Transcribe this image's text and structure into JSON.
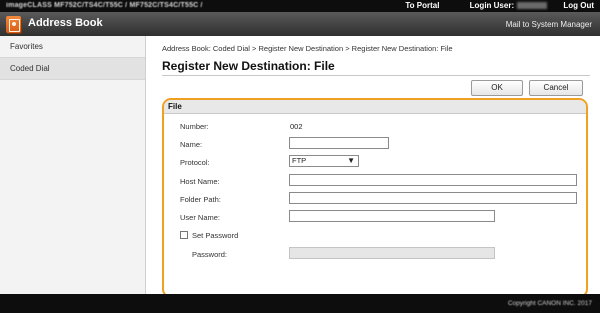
{
  "topbar": {
    "model": "imageCLASS  MF752C/TS4C/T55C / MF752C/TS4C/T55C /",
    "to_portal": "To Portal",
    "login_user_label": "Login User:",
    "log_out": "Log Out"
  },
  "header": {
    "title": "Address Book",
    "mail_link": "Mail to System Manager",
    "icon": "address-book-icon"
  },
  "sidebar": {
    "items": [
      {
        "label": "Favorites"
      },
      {
        "label": "Coded Dial"
      }
    ]
  },
  "main": {
    "breadcrumb": "Address Book: Coded Dial > Register New Destination > Register New Destination: File",
    "title": "Register New Destination: File",
    "ok_label": "OK",
    "cancel_label": "Cancel",
    "panel": {
      "heading": "File",
      "number_label": "Number:",
      "number_value": "002",
      "name_label": "Name:",
      "name_value": "",
      "protocol_label": "Protocol:",
      "protocol_value": "FTP",
      "host_label": "Host Name:",
      "host_value": "",
      "path_label": "Folder Path:",
      "path_value": "",
      "user_label": "User Name:",
      "user_value": "",
      "set_password_label": "Set Password",
      "password_label": "Password:",
      "password_value": ""
    }
  },
  "footer": {
    "copyright": "Copyright CANON INC. 2017"
  },
  "colors": {
    "highlight": "#f0a020",
    "brand_orange": "#e06a20"
  }
}
